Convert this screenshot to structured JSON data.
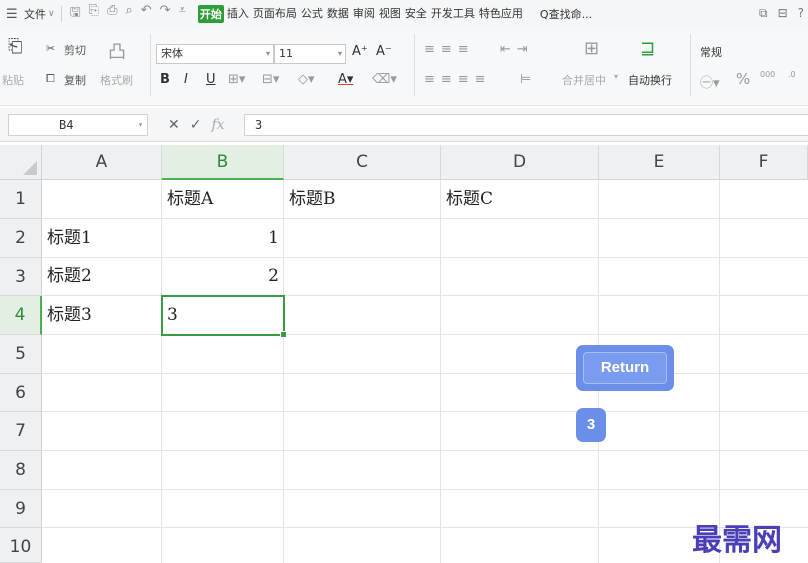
{
  "menu": {
    "file_label": "文件",
    "tabs": [
      "开始",
      "插入",
      "页面布局",
      "公式",
      "数据",
      "审阅",
      "视图",
      "安全",
      "开发工具",
      "特色应用"
    ],
    "active_tab": "开始",
    "search_label": "Q查找命..."
  },
  "ribbon": {
    "paste_label": "粘贴",
    "cut_label": "剪切",
    "copy_label": "复制",
    "format_painter_label": "格式刷",
    "font_name": "宋体",
    "font_size": "11",
    "merge_center_label": "合并居中",
    "wrap_text_label": "自动换行",
    "number_format": "常规"
  },
  "formula_bar": {
    "cell_ref": "B4",
    "formula_value": "3"
  },
  "sheet": {
    "columns": [
      "A",
      "B",
      "C",
      "D",
      "E",
      "F"
    ],
    "rows": [
      "1",
      "2",
      "3",
      "4",
      "5",
      "6",
      "7",
      "8",
      "9",
      "10"
    ],
    "cells": {
      "B1": "标题A",
      "C1": "标题B",
      "D1": "标题C",
      "A2": "标题1",
      "B2": "1",
      "A3": "标题2",
      "B3": "2",
      "A4": "标题3",
      "B4": "3"
    },
    "selected_column": "B",
    "selected_row": "4"
  },
  "overlay": {
    "return_key": "Return",
    "typed_key": "3"
  },
  "watermark": "最需网",
  "colors": {
    "accent_green": "#3a9b45",
    "active_tab_bg": "#2e9e38",
    "key_badge": "#6b8ee8",
    "watermark": "#4a3fb8"
  }
}
